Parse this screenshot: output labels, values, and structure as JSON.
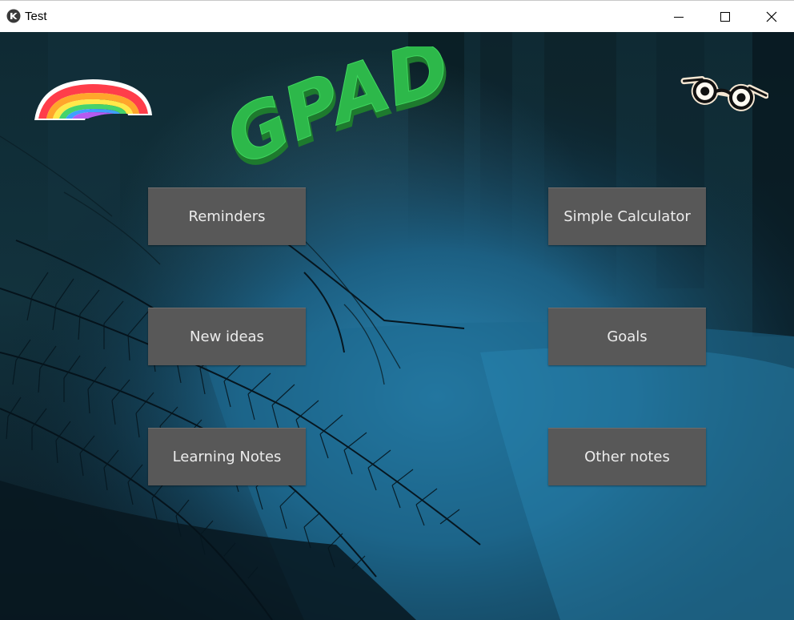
{
  "window": {
    "title": "Test",
    "controls": {
      "minimize_icon": "minimize-icon",
      "maximize_icon": "maximize-icon",
      "close_icon": "close-icon"
    }
  },
  "header": {
    "logo_text": "GPAD",
    "logo_color": "#2db84a",
    "left_decoration": "rainbow-icon",
    "right_decoration": "glasses-icon"
  },
  "buttons": {
    "reminders": "Reminders",
    "new_ideas": "New ideas",
    "learning_notes": "Learning Notes",
    "simple_calculator": "Simple Calculator",
    "goals": "Goals",
    "other_notes": "Other notes"
  },
  "colors": {
    "button_bg": "#585858",
    "button_text": "#ececec",
    "background_dark": "#0b1e26",
    "background_blue": "#1f6f95"
  }
}
